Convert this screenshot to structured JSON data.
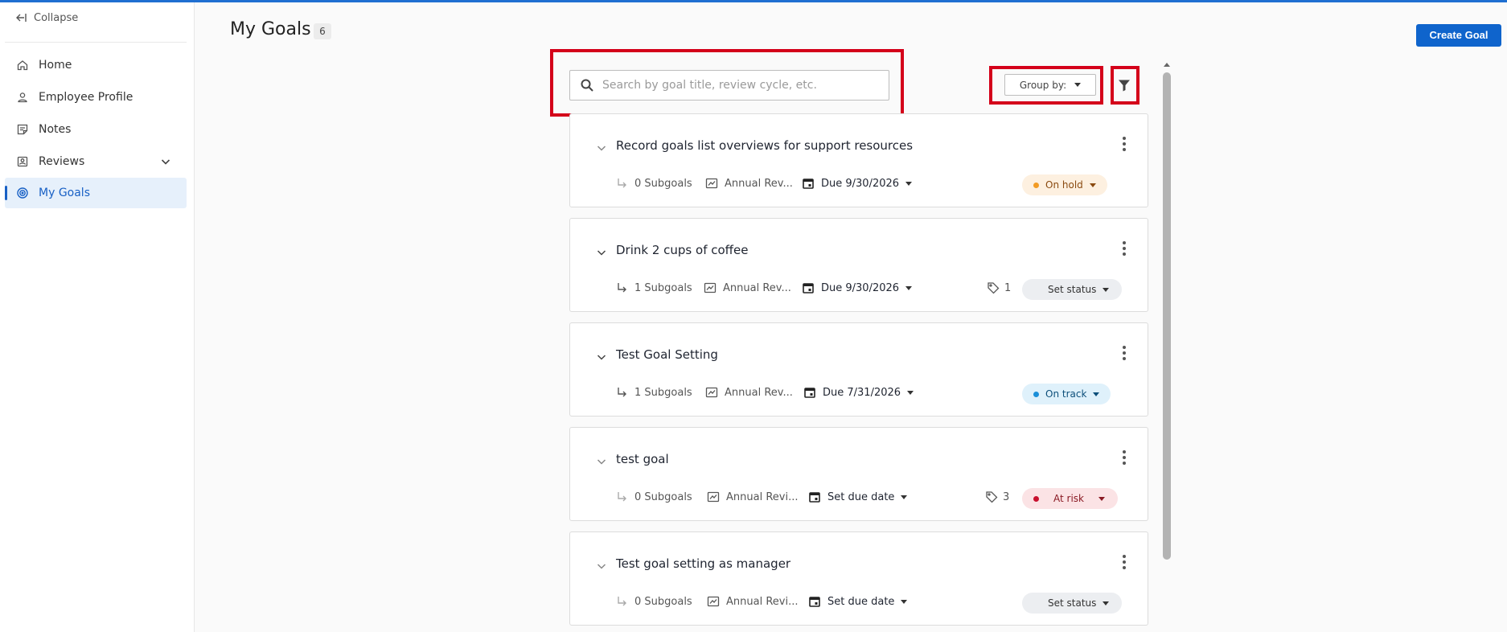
{
  "sidebar": {
    "collapse_label": "Collapse",
    "items": [
      {
        "label": "Home",
        "icon": "home-icon"
      },
      {
        "label": "Employee Profile",
        "icon": "person-icon"
      },
      {
        "label": "Notes",
        "icon": "notes-icon"
      },
      {
        "label": "Reviews",
        "icon": "reviews-icon"
      },
      {
        "label": "My Goals",
        "icon": "target-icon"
      }
    ]
  },
  "header": {
    "title": "My Goals",
    "count": "6",
    "create_label": "Create Goal"
  },
  "toolbar": {
    "search_placeholder": "Search by goal title, review cycle, etc.",
    "group_by_label": "Group by:"
  },
  "colors": {
    "accent": "#0f64cc",
    "highlight": "#d4001a",
    "on_hold_bg": "#fdf0e0",
    "on_track_bg": "#dff1fb",
    "at_risk_bg": "#fbe3e5",
    "neutral_bg": "#eceef1"
  },
  "goals": [
    {
      "title": "Record goals list overviews for support resources",
      "subgoals": "0 Subgoals",
      "cycle": "Annual Rev...",
      "due": "Due 9/30/2026",
      "tags": "",
      "status": "On hold"
    },
    {
      "title": "Drink 2 cups of coffee",
      "subgoals": "1 Subgoals",
      "cycle": "Annual Rev...",
      "due": "Due 9/30/2026",
      "tags": "1",
      "status": "Set status"
    },
    {
      "title": "Test Goal Setting",
      "subgoals": "1 Subgoals",
      "cycle": "Annual Rev...",
      "due": "Due 7/31/2026",
      "tags": "",
      "status": "On track"
    },
    {
      "title": "test goal",
      "subgoals": "0 Subgoals",
      "cycle": "Annual Revi...",
      "due": "Set due date",
      "tags": "3",
      "status": "At risk"
    },
    {
      "title": "Test goal setting as manager",
      "subgoals": "0 Subgoals",
      "cycle": "Annual Revi...",
      "due": "Set due date",
      "tags": "",
      "status": "Set status"
    }
  ]
}
